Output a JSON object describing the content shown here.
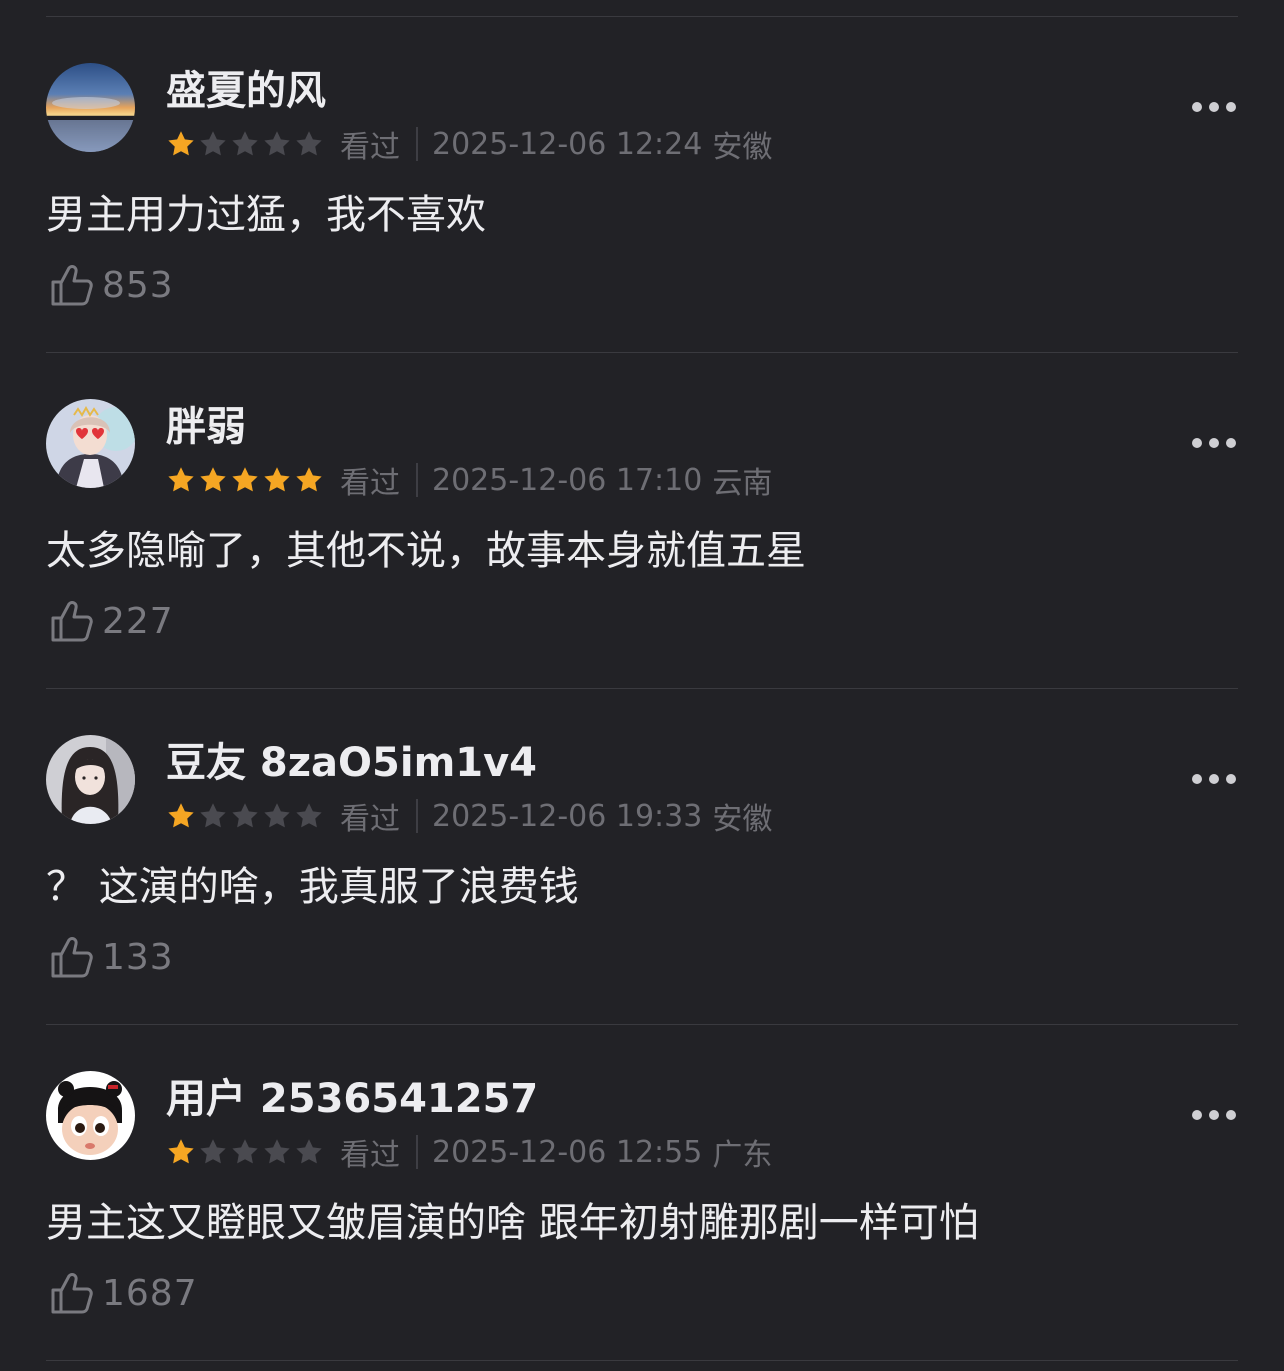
{
  "reviews": [
    {
      "username": "盛夏的风",
      "rating": 1,
      "status": "看过",
      "datetime": "2025-12-06 12:24",
      "location": "安徽",
      "content": "男主用力过猛，我不喜欢",
      "likes": "853",
      "avatar_icon": "sunset-landscape-avatar"
    },
    {
      "username": "胖弱",
      "rating": 5,
      "status": "看过",
      "datetime": "2025-12-06 17:10",
      "location": "云南",
      "content": "太多隐喻了，其他不说，故事本身就值五星",
      "likes": "227",
      "avatar_icon": "girl-with-heart-glasses-avatar"
    },
    {
      "username": "豆友 8zaO5im1v4",
      "rating": 1,
      "status": "看过",
      "datetime": "2025-12-06 19:33",
      "location": "安徽",
      "content": "？ 这演的啥，我真服了浪费钱",
      "likes": "133",
      "avatar_icon": "girl-portrait-avatar"
    },
    {
      "username": "用户 2536541257",
      "rating": 1,
      "status": "看过",
      "datetime": "2025-12-06 12:55",
      "location": "广东",
      "content": "男主这又瞪眼又皱眉演的啥 跟年初射雕那剧一样可怕",
      "likes": "1687",
      "avatar_icon": "cartoon-character-avatar"
    }
  ],
  "colors": {
    "background": "#222226",
    "star_filled": "#f5a623",
    "star_empty": "#4a4a50",
    "meta_text": "#6e6e74",
    "primary_text": "#ededf0"
  },
  "icons": {
    "more": "more-options-icon",
    "like": "thumbs-up-icon",
    "star": "star-icon"
  }
}
